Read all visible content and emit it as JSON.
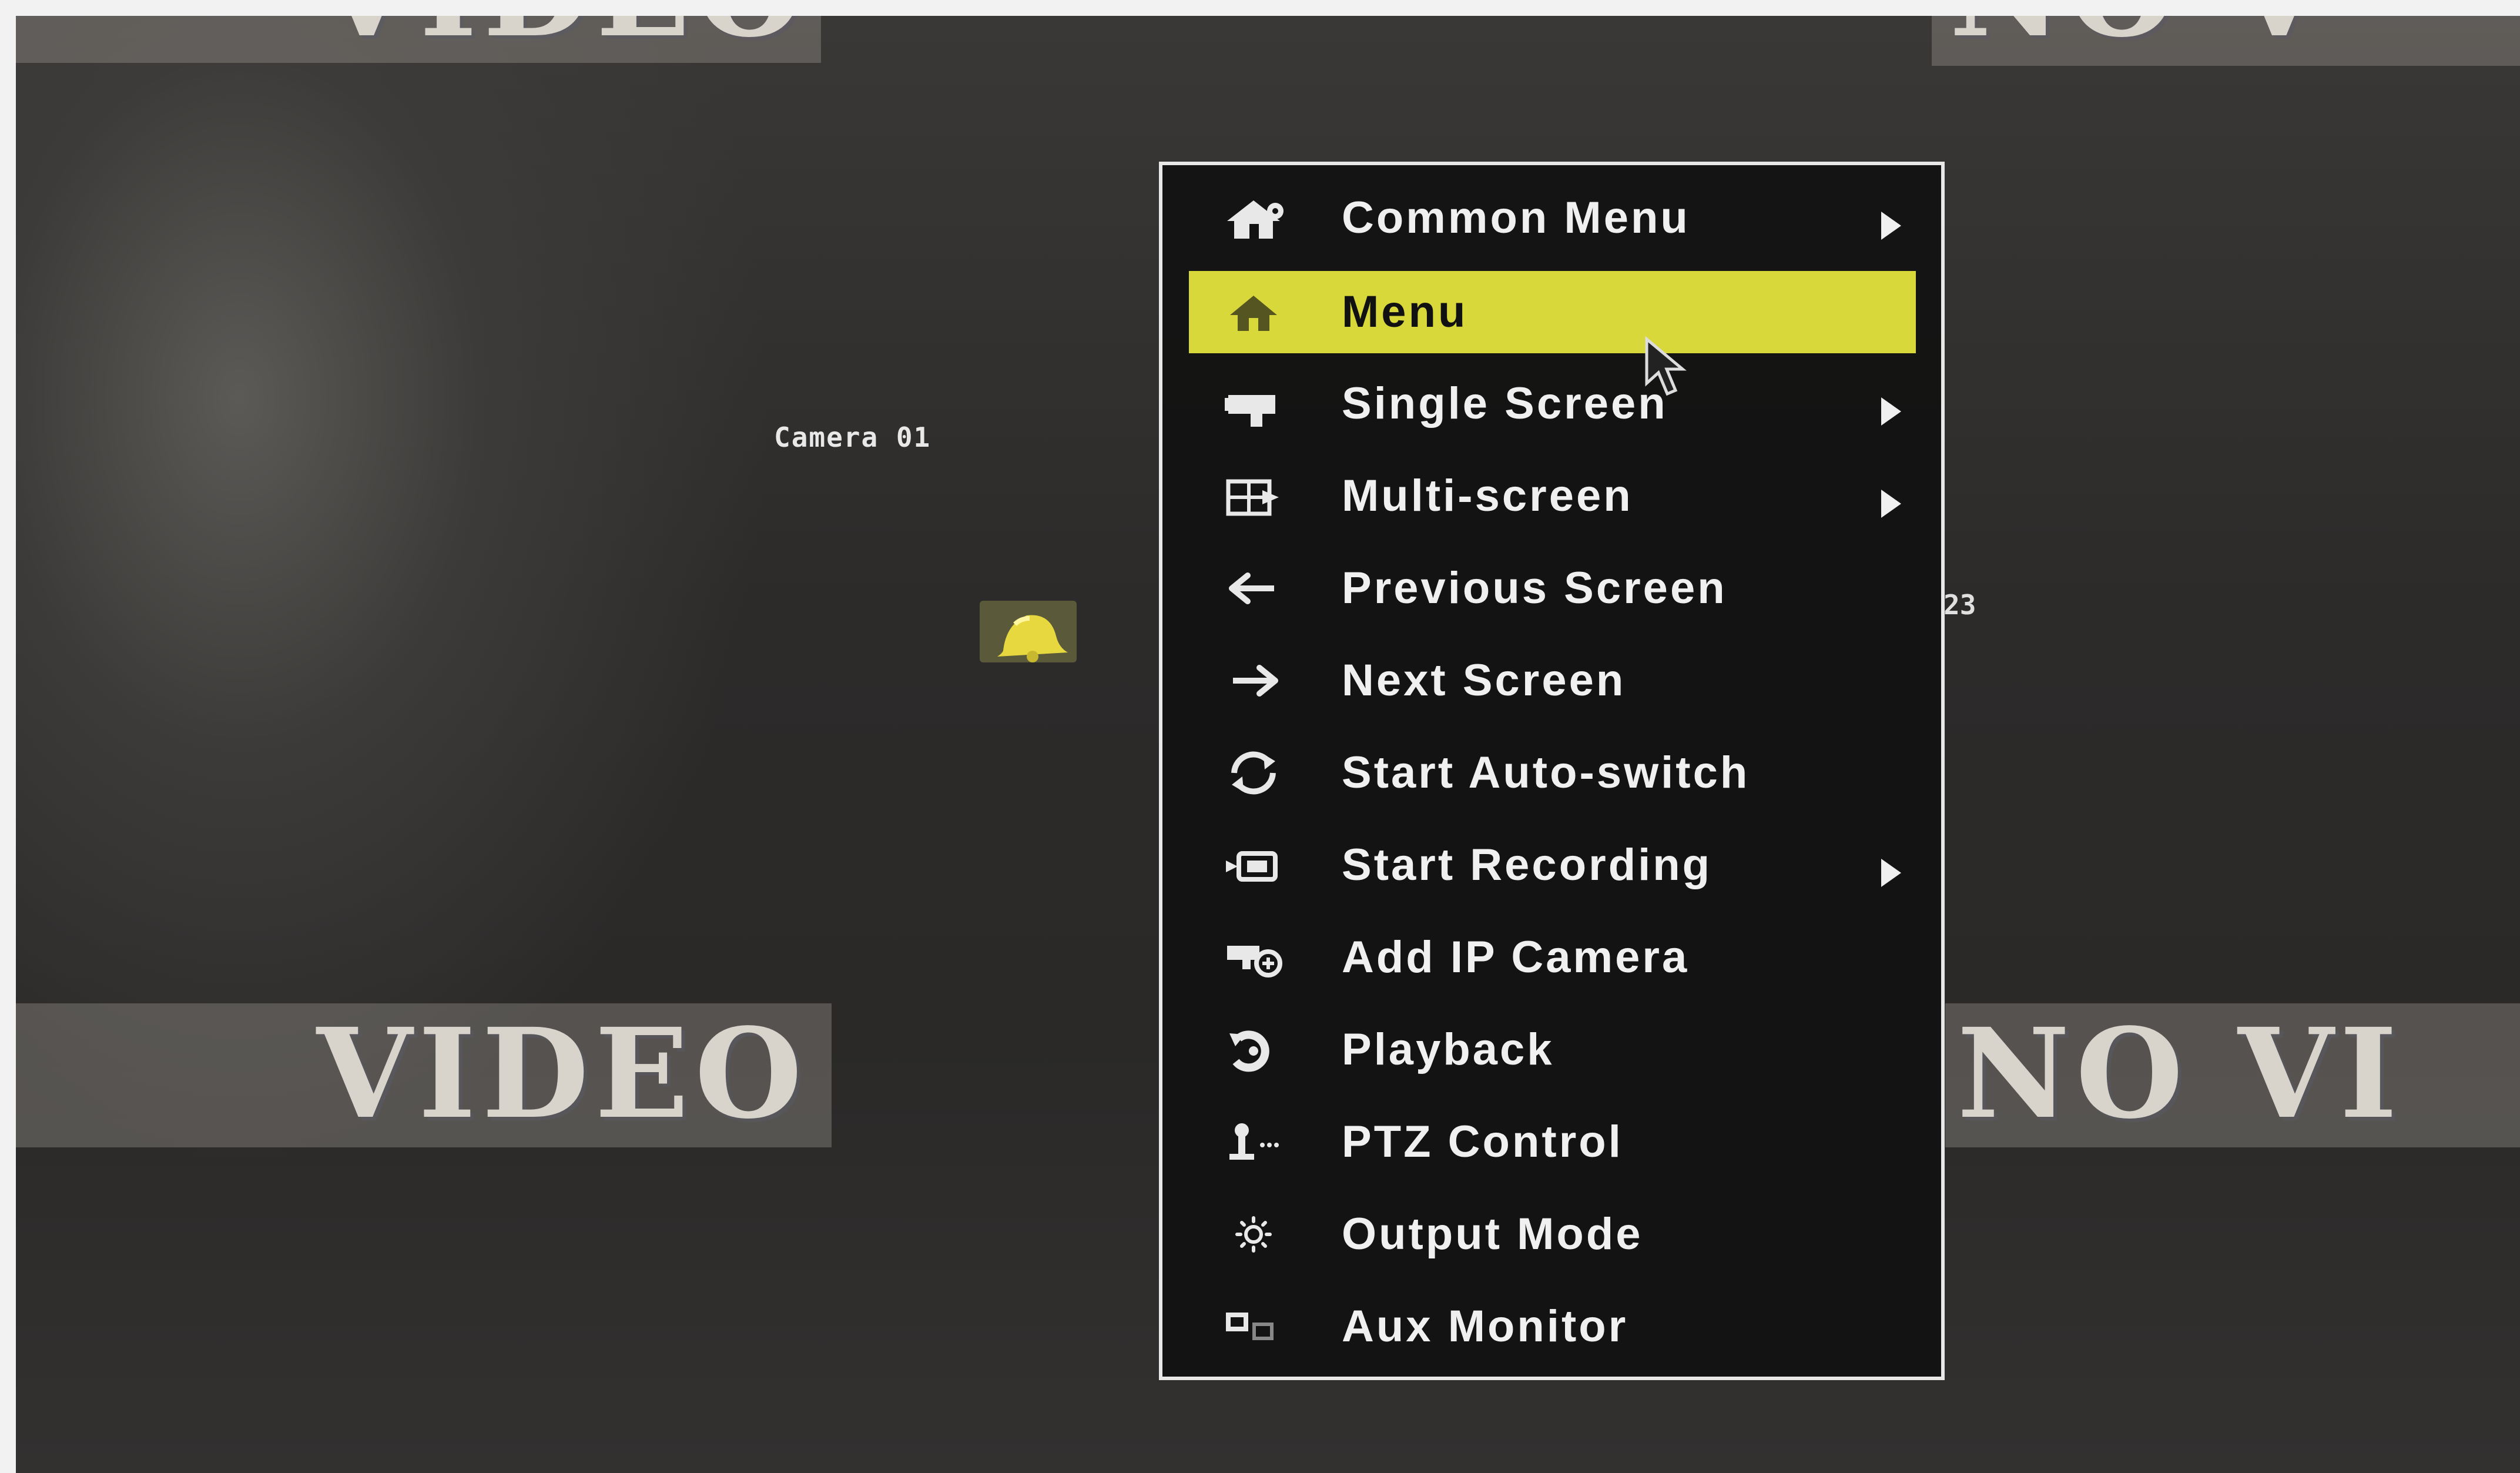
{
  "background": {
    "no_video_tl": "VIDEO",
    "no_video_tr": "NO V",
    "no_video_bl": "VIDEO",
    "no_video_br": "NO VI",
    "camera_label": "Camera 01",
    "side_number": "23"
  },
  "menu": {
    "items": [
      {
        "label": "Common Menu",
        "icon": "home-gear-icon",
        "submenu": true
      },
      {
        "label": "Menu",
        "icon": "home-icon",
        "submenu": false,
        "selected": true
      },
      {
        "label": "Single Screen",
        "icon": "camera-icon",
        "submenu": true
      },
      {
        "label": "Multi-screen",
        "icon": "multi-screen-icon",
        "submenu": true
      },
      {
        "label": "Previous Screen",
        "icon": "arrow-left-icon",
        "submenu": false
      },
      {
        "label": "Next Screen",
        "icon": "arrow-right-icon",
        "submenu": false
      },
      {
        "label": "Start Auto-switch",
        "icon": "refresh-icon",
        "submenu": false
      },
      {
        "label": "Start Recording",
        "icon": "record-icon",
        "submenu": true
      },
      {
        "label": "Add IP Camera",
        "icon": "add-camera-icon",
        "submenu": false
      },
      {
        "label": "Playback",
        "icon": "playback-icon",
        "submenu": false
      },
      {
        "label": "PTZ Control",
        "icon": "ptz-icon",
        "submenu": false
      },
      {
        "label": "Output Mode",
        "icon": "sun-icon",
        "submenu": false
      },
      {
        "label": "Aux Monitor",
        "icon": "aux-monitor-icon",
        "submenu": false
      }
    ]
  },
  "colors": {
    "highlight": "#d8d83a",
    "menu_border": "#e8e8e8",
    "menu_bg": "#121212"
  }
}
